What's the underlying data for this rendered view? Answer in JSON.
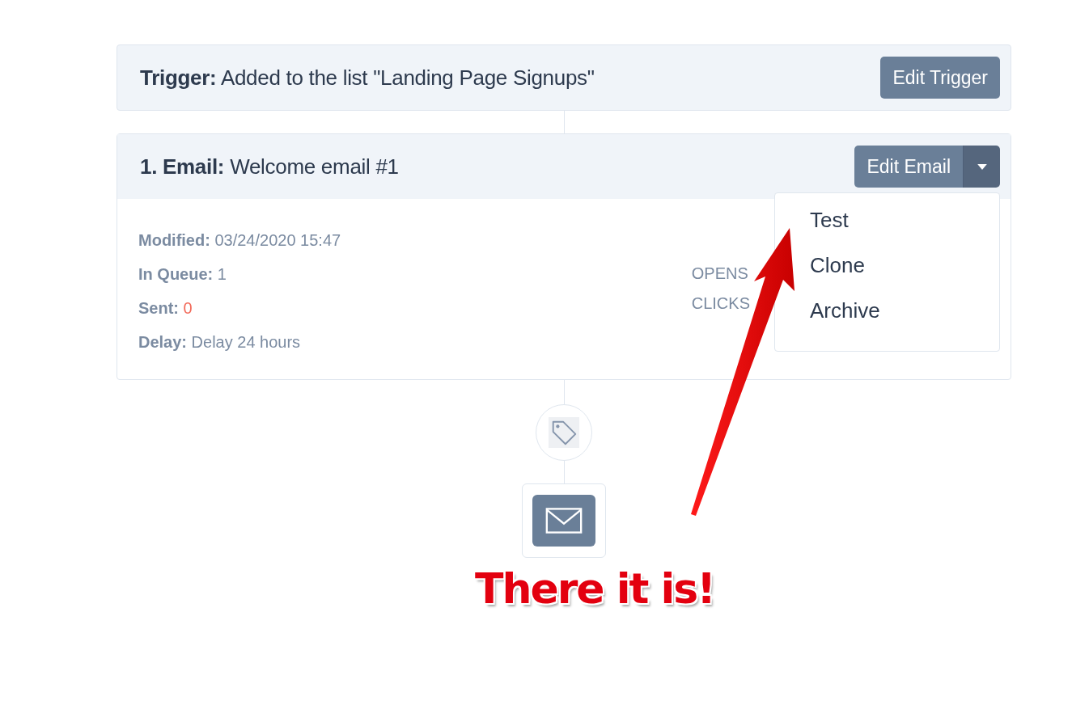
{
  "trigger": {
    "label": "Trigger:",
    "text": "Added to the list \"Landing Page Signups\"",
    "button": "Edit Trigger"
  },
  "step": {
    "label": "1. Email:",
    "title": "Welcome email #1",
    "button": "Edit Email",
    "menu_expanded": true,
    "menu": [
      {
        "label": "Test"
      },
      {
        "label": "Clone"
      },
      {
        "label": "Archive"
      }
    ],
    "details": [
      {
        "label": "Modified:",
        "value": "03/24/2020 15:47",
        "kind": "plain"
      },
      {
        "label": "In Queue:",
        "value": "1",
        "kind": "plain"
      },
      {
        "label": "Sent:",
        "value": "0",
        "kind": "alert"
      },
      {
        "label": "Delay:",
        "value": "Delay 24 hours",
        "kind": "plain"
      }
    ],
    "stats": [
      "OPENS",
      "CLICKS"
    ]
  },
  "annotation": {
    "text": "There it is!"
  }
}
